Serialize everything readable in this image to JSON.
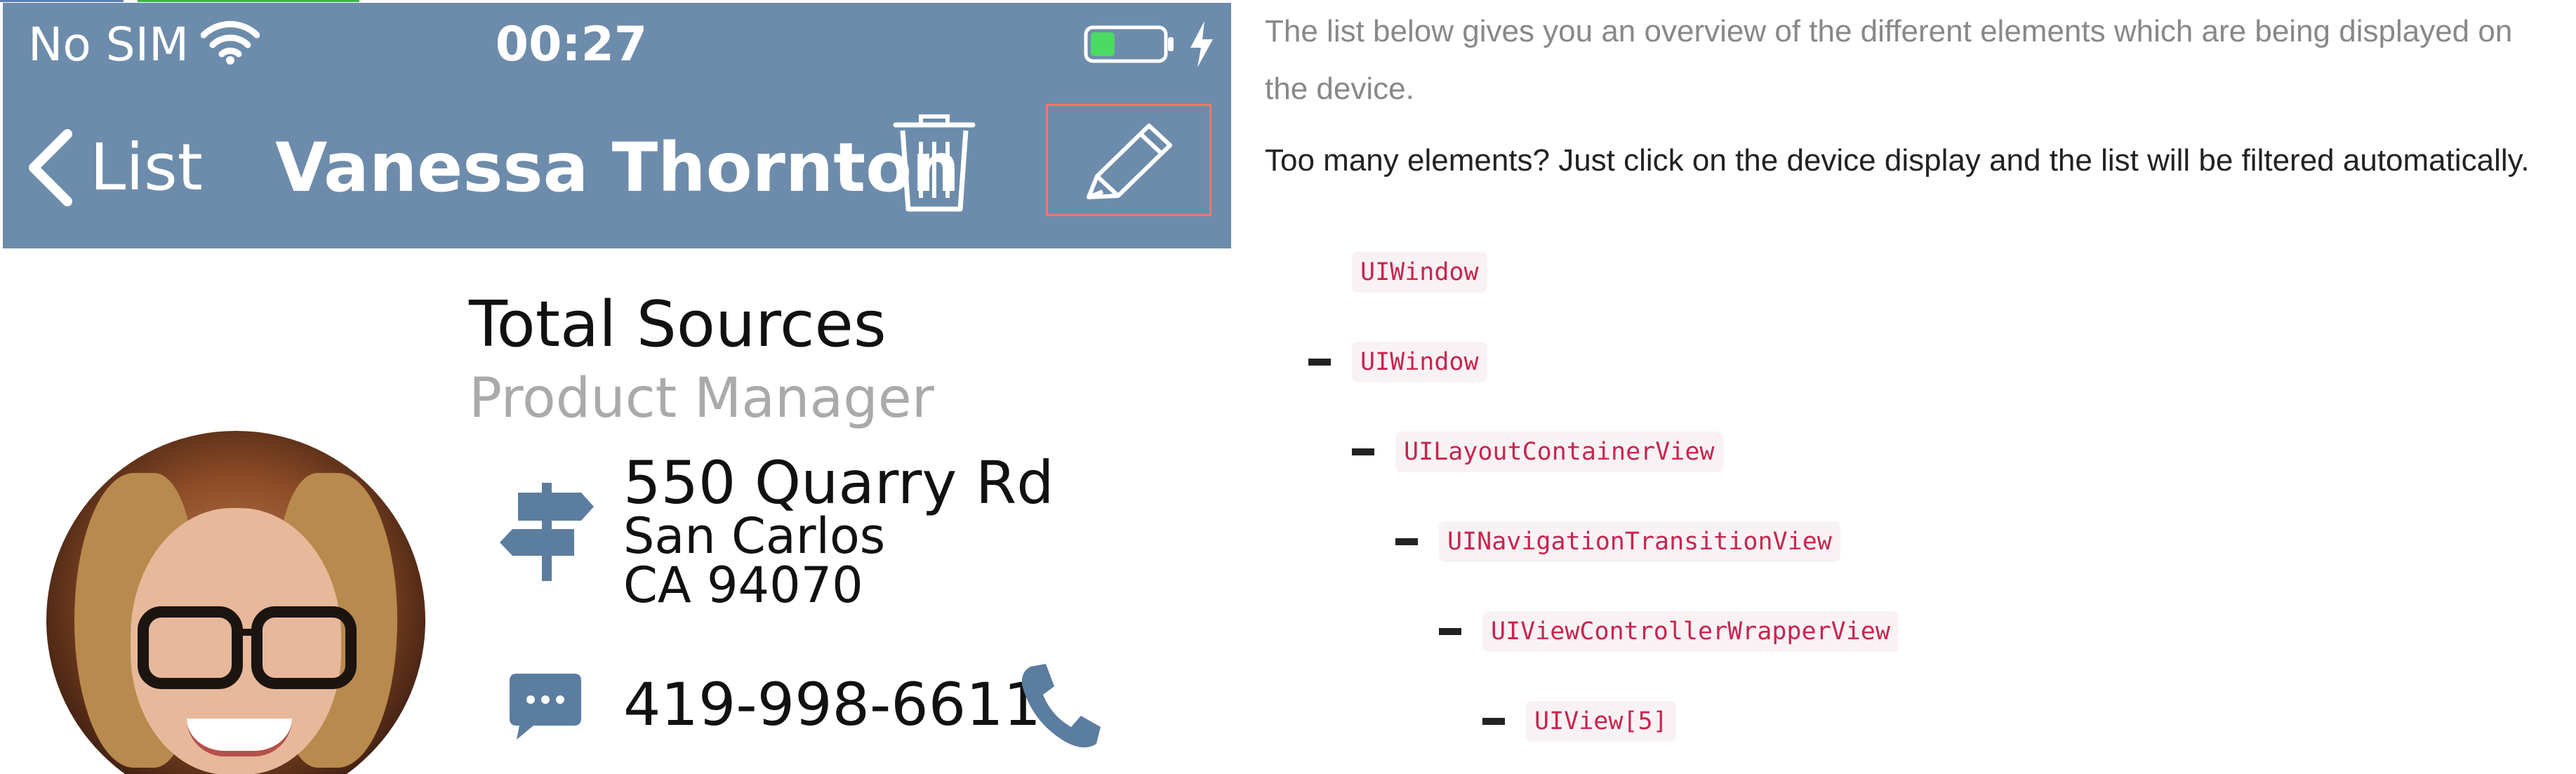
{
  "device": {
    "status_bar": {
      "carrier": "No SIM",
      "time": "00:27"
    },
    "nav_bar": {
      "back_label": "List",
      "title": "Vanessa Thornton"
    },
    "contact": {
      "company": "Total Sources",
      "role": "Product Manager",
      "address": [
        "550 Quarry Rd",
        "San Carlos",
        "CA 94070"
      ],
      "phone": "419-998-6611"
    }
  },
  "panel": {
    "intro": "The list below gives you an overview of the different elements which are being displayed on the device.",
    "hint": "Too many elements? Just click on the device display and the list will be filtered automatically.",
    "tree": [
      {
        "label": "UIWindow",
        "collapsible": false,
        "depth": 0
      },
      {
        "label": "UIWindow",
        "collapsible": true,
        "depth": 0
      },
      {
        "label": "UILayoutContainerView",
        "collapsible": true,
        "depth": 1
      },
      {
        "label": "UINavigationTransitionView",
        "collapsible": true,
        "depth": 2
      },
      {
        "label": "UIViewControllerWrapperView",
        "collapsible": true,
        "depth": 3
      },
      {
        "label": "UIView[5]",
        "collapsible": true,
        "depth": 4
      }
    ]
  },
  "colors": {
    "nav_bar": "#6d8cab",
    "highlight": "#ef7a63",
    "tag_text": "#c7254e",
    "tag_bg": "#f9f2f4",
    "icon_blue": "#5b7d9f"
  },
  "icons": [
    "wifi-icon",
    "battery-icon",
    "charging-icon",
    "back-chevron-icon",
    "trash-icon",
    "pencil-icon",
    "signpost-icon",
    "message-icon",
    "phone-icon"
  ]
}
